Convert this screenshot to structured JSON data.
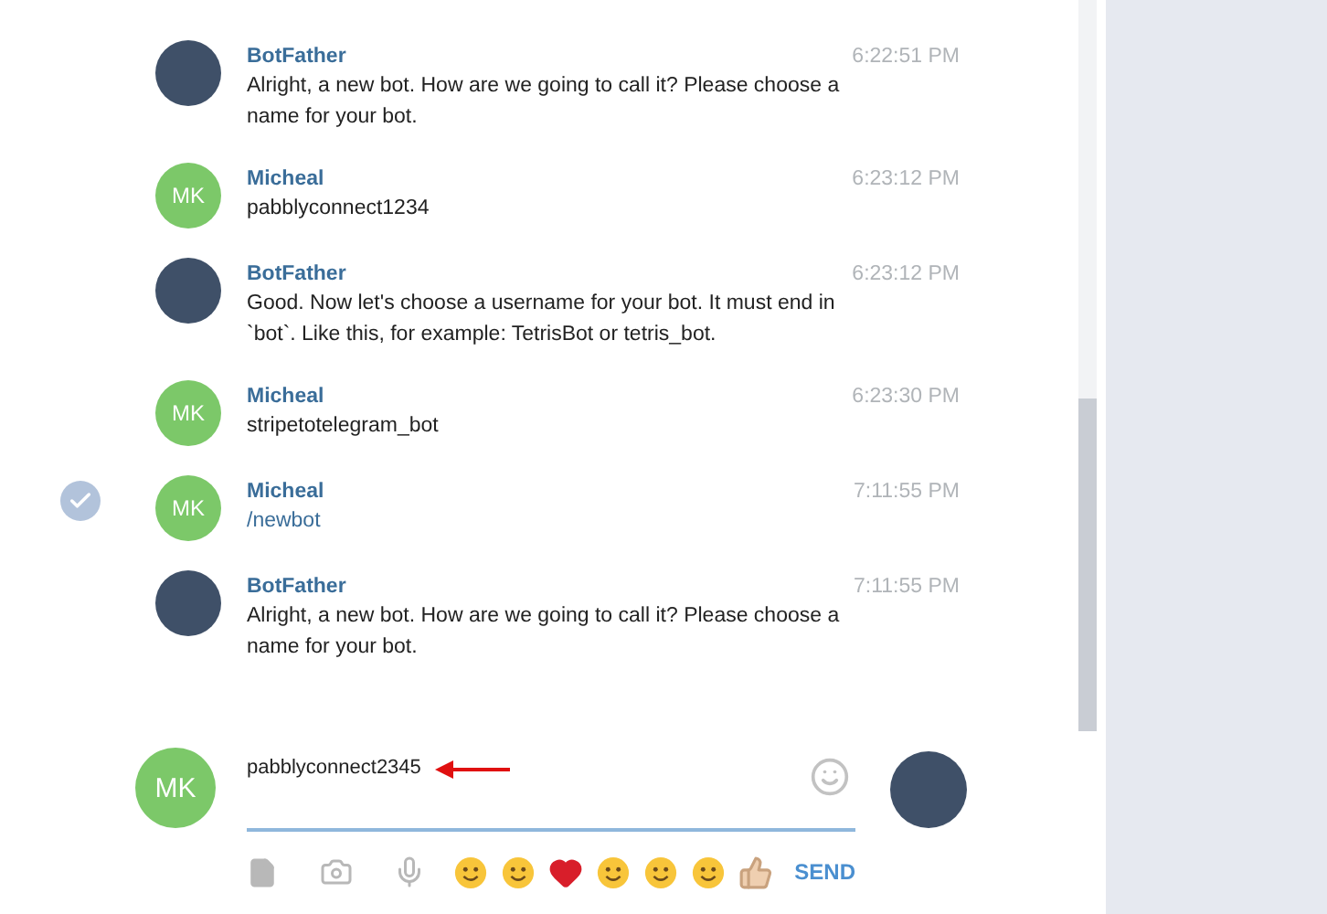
{
  "messages": [
    {
      "sender": "BotFather",
      "kind": "photo",
      "time": "6:22:51 PM",
      "text": "Alright, a new bot. How are we going to call it? Please choose a name for your bot.",
      "is_command": false,
      "selected": false
    },
    {
      "sender": "Micheal",
      "kind": "initials",
      "initials": "MK",
      "time": "6:23:12 PM",
      "text": "pabblyconnect1234",
      "is_command": false,
      "selected": false
    },
    {
      "sender": "BotFather",
      "kind": "photo",
      "time": "6:23:12 PM",
      "text": "Good. Now let's choose a username for your bot. It must end in `bot`. Like this, for example: TetrisBot or tetris_bot.",
      "is_command": false,
      "selected": false
    },
    {
      "sender": "Micheal",
      "kind": "initials",
      "initials": "MK",
      "time": "6:23:30 PM",
      "text": "stripetotelegram_bot",
      "is_command": false,
      "selected": false
    },
    {
      "sender": "Micheal",
      "kind": "initials",
      "initials": "MK",
      "time": "7:11:55 PM",
      "text": "/newbot",
      "is_command": true,
      "selected": true
    },
    {
      "sender": "BotFather",
      "kind": "photo",
      "time": "7:11:55 PM",
      "text": "Alright, a new bot. How are we going to call it? Please choose a name for your bot.",
      "is_command": false,
      "selected": false
    }
  ],
  "composer": {
    "initials": "MK",
    "value": "pabblyconnect2345",
    "send": "SEND"
  }
}
